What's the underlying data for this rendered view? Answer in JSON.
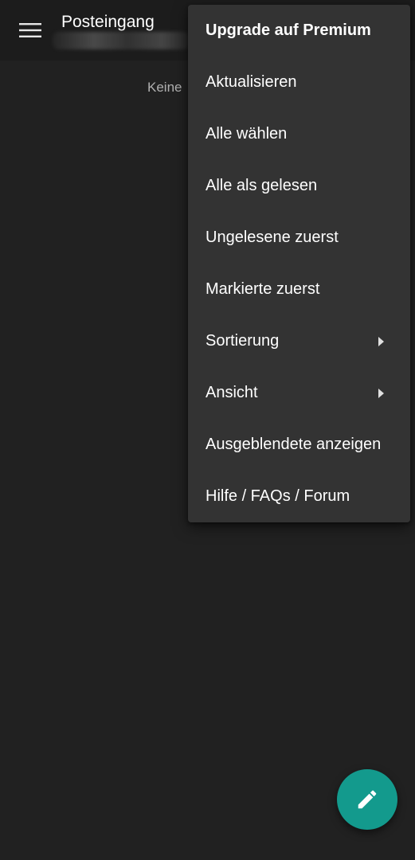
{
  "app_bar": {
    "title": "Posteingang",
    "menu_icon": "hamburger-menu-icon"
  },
  "main": {
    "empty_text": "Keine"
  },
  "overflow_menu": {
    "items": [
      {
        "label": "Upgrade auf Premium",
        "bold": true,
        "submenu": false
      },
      {
        "label": "Aktualisieren",
        "submenu": false
      },
      {
        "label": "Alle wählen",
        "submenu": false
      },
      {
        "label": "Alle als gelesen",
        "submenu": false
      },
      {
        "label": "Ungelesene zuerst",
        "submenu": false
      },
      {
        "label": "Markierte zuerst",
        "submenu": false
      },
      {
        "label": "Sortierung",
        "submenu": true
      },
      {
        "label": "Ansicht",
        "submenu": true
      },
      {
        "label": "Ausgeblendete anzeigen",
        "submenu": false
      },
      {
        "label": "Hilfe / FAQs / Forum",
        "submenu": false
      }
    ]
  },
  "fab": {
    "icon": "pencil-icon",
    "color": "#139a8d"
  },
  "colors": {
    "background": "#212121",
    "app_bar": "#1c1c1c",
    "menu_background": "#333333",
    "text": "#ffffff"
  }
}
